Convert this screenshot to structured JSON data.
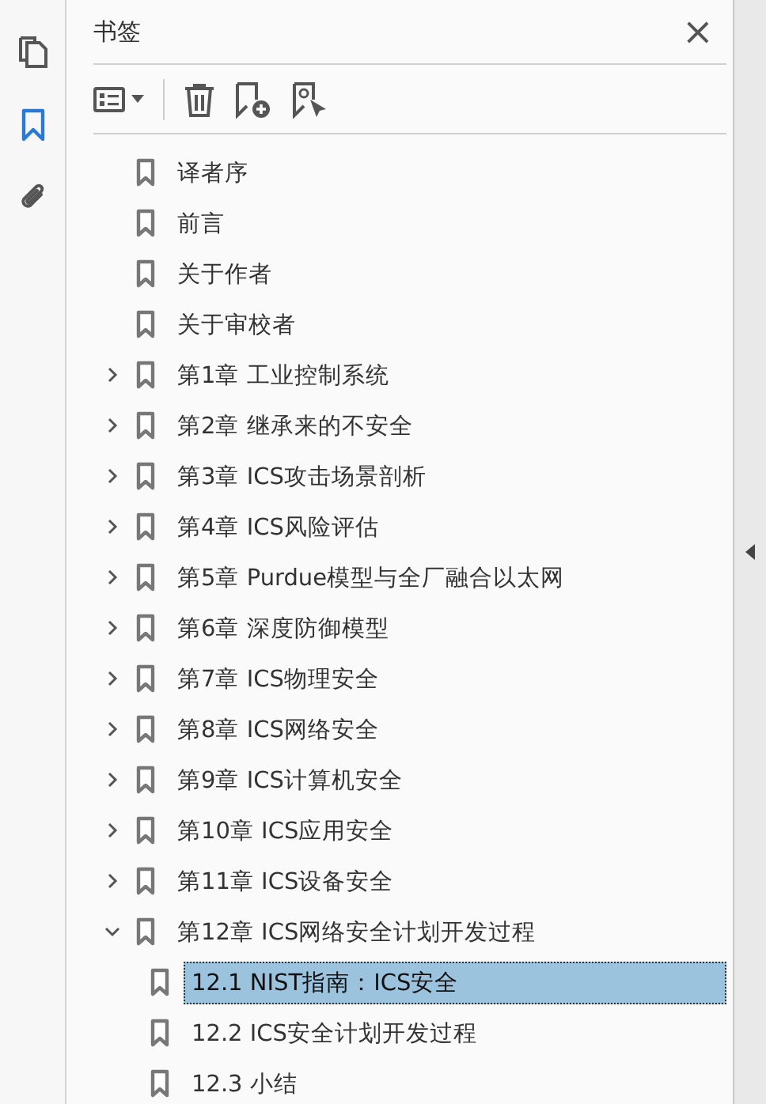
{
  "panel": {
    "title": "书签",
    "close": "×"
  },
  "bookmarks": [
    {
      "label": "译者序"
    },
    {
      "label": "前言"
    },
    {
      "label": "关于作者"
    },
    {
      "label": "关于审校者"
    },
    {
      "label": "第1章 工业控制系统",
      "expanded": false
    },
    {
      "label": "第2章 继承来的不安全",
      "expanded": false
    },
    {
      "label": "第3章 ICS攻击场景剖析",
      "expanded": false
    },
    {
      "label": "第4章 ICS风险评估",
      "expanded": false
    },
    {
      "label": "第5章 Purdue模型与全厂融合以太网",
      "expanded": false
    },
    {
      "label": "第6章 深度防御模型",
      "expanded": false
    },
    {
      "label": "第7章 ICS物理安全",
      "expanded": false
    },
    {
      "label": "第8章 ICS网络安全",
      "expanded": false
    },
    {
      "label": "第9章 ICS计算机安全",
      "expanded": false
    },
    {
      "label": "第10章 ICS应用安全",
      "expanded": false
    },
    {
      "label": "第11章 ICS设备安全",
      "expanded": false
    },
    {
      "label": "第12章 ICS网络安全计划开发过程",
      "expanded": true,
      "children": [
        {
          "label": "12.1 NIST指南：ICS安全",
          "selected": true
        },
        {
          "label": "12.2 ICS安全计划开发过程",
          "selected": false
        },
        {
          "label": "12.3 小结",
          "selected": false
        }
      ]
    }
  ]
}
